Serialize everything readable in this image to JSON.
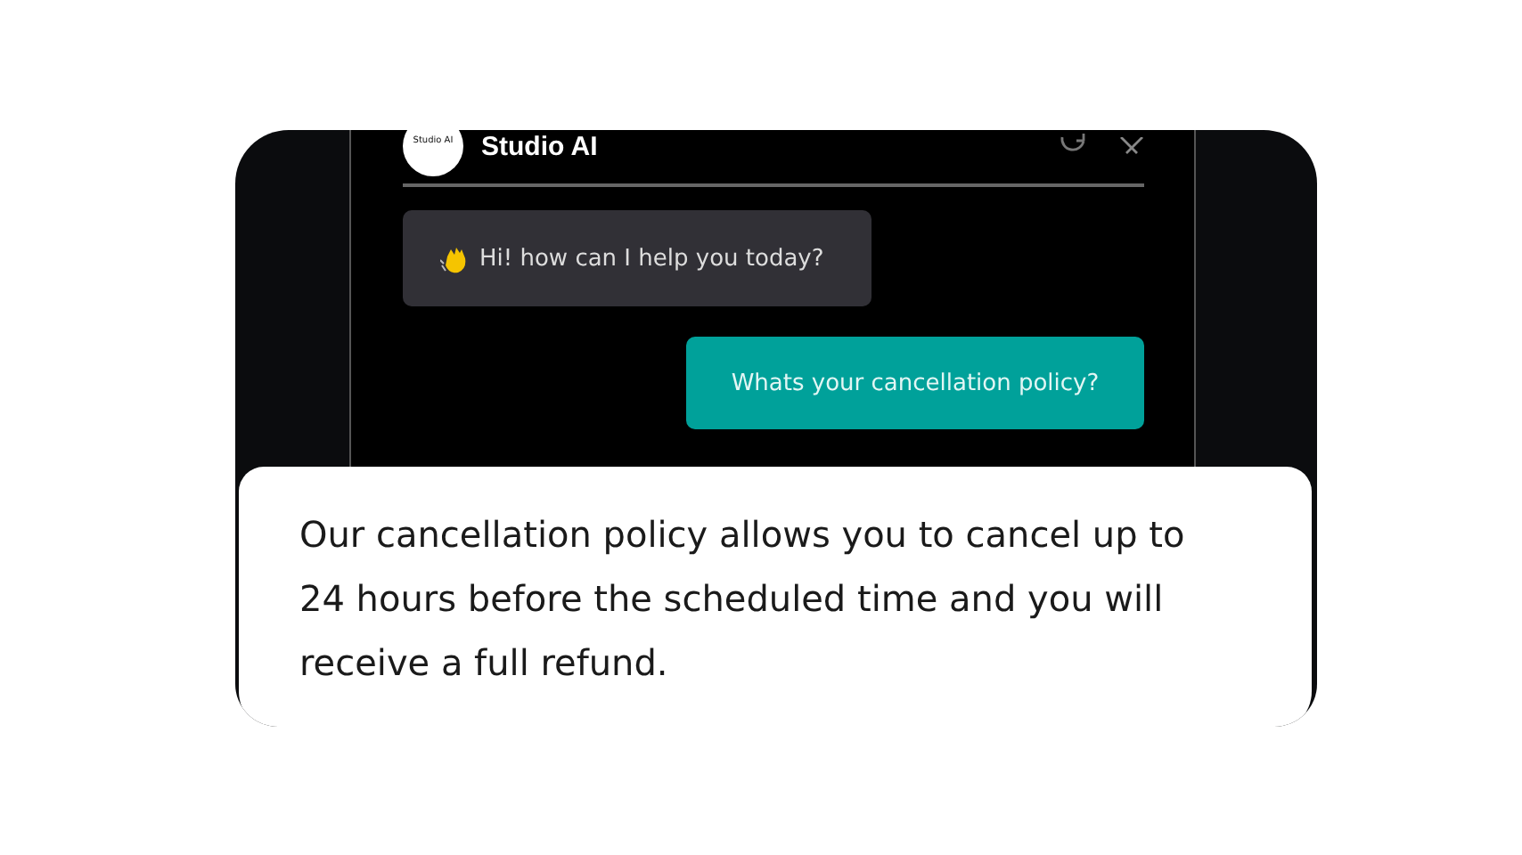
{
  "chat": {
    "avatar_label": "Studio AI",
    "title": "Studio AI"
  },
  "messages": [
    {
      "kind": "bot",
      "text": "Hi! how can I help you today?"
    },
    {
      "kind": "user",
      "text": "Whats your cancellation policy?"
    }
  ],
  "answer": "Our cancellation policy allows you to cancel up to 24 hours before the scheduled time and you will receive a full refund."
}
